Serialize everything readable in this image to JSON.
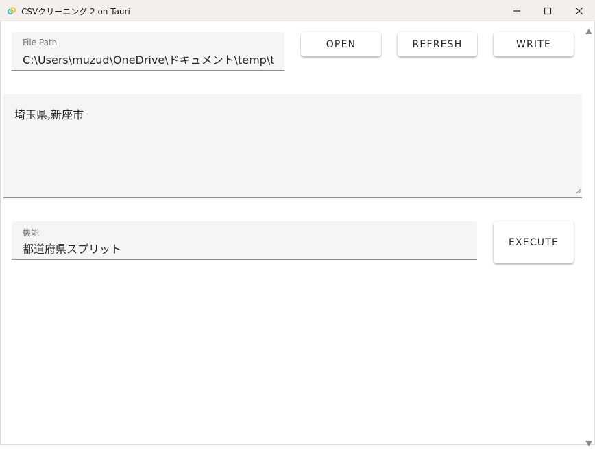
{
  "window": {
    "title": "CSVクリーニング 2 on Tauri",
    "icon": "tauri-logo-icon",
    "controls": [
      "minimize-icon",
      "maximize-icon",
      "close-icon"
    ]
  },
  "file_path": {
    "label": "File Path",
    "value": "C:\\Users\\muzud\\OneDrive\\ドキュメント\\temp\\temp"
  },
  "toolbar": {
    "open_label": "OPEN",
    "refresh_label": "REFRESH",
    "write_label": "WRITE"
  },
  "preview": {
    "text": "埼玉県,新座市"
  },
  "function_select": {
    "label": "機能",
    "value": "都道府県スプリット"
  },
  "execute_label": "EXECUTE",
  "colors": {
    "titlebar_bg": "#f3efec",
    "field_bg": "#f5f5f5",
    "text": "#262626",
    "label": "#757575"
  }
}
